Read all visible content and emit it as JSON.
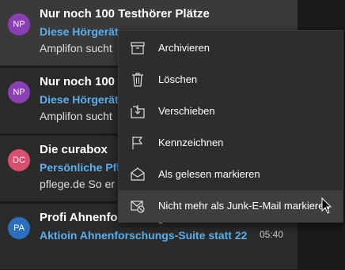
{
  "emails": [
    {
      "initials": "NP",
      "avatar_color": "#8b3fb5",
      "sender": "Nur noch 100 Testhörer Plätze",
      "subject": "Diese Hörgerät",
      "preview": "Amplifon sucht",
      "time": ""
    },
    {
      "initials": "NP",
      "avatar_color": "#8b3fb5",
      "sender": "Nur noch 100 T",
      "subject": "Diese Hörgerät",
      "preview": "Amplifon sucht",
      "time": ""
    },
    {
      "initials": "DC",
      "avatar_color": "#d94f70",
      "sender": "Die curabox",
      "subject": "Persönliche Pfl",
      "preview": "pflege.de So er",
      "time": ""
    },
    {
      "initials": "PA",
      "avatar_color": "#2b6fc0",
      "sender": "Profi Ahnenforschung",
      "subject": "Aktioin Ahnenforschungs-Suite statt 22",
      "preview": "",
      "time": "05:40"
    }
  ],
  "context_menu": {
    "items": [
      {
        "label": "Archivieren",
        "icon": "archive-icon"
      },
      {
        "label": "Löschen",
        "icon": "trash-icon"
      },
      {
        "label": "Verschieben",
        "icon": "move-icon"
      },
      {
        "label": "Kennzeichnen",
        "icon": "flag-icon"
      },
      {
        "label": "Als gelesen markieren",
        "icon": "envelope-open-icon"
      },
      {
        "label": "Nicht mehr als Junk-E-Mail markieren",
        "icon": "not-junk-icon"
      }
    ]
  },
  "colors": {
    "accent": "#5ab0f0",
    "menu_bg": "#2d2d2d",
    "list_bg": "#2b2b2b"
  }
}
